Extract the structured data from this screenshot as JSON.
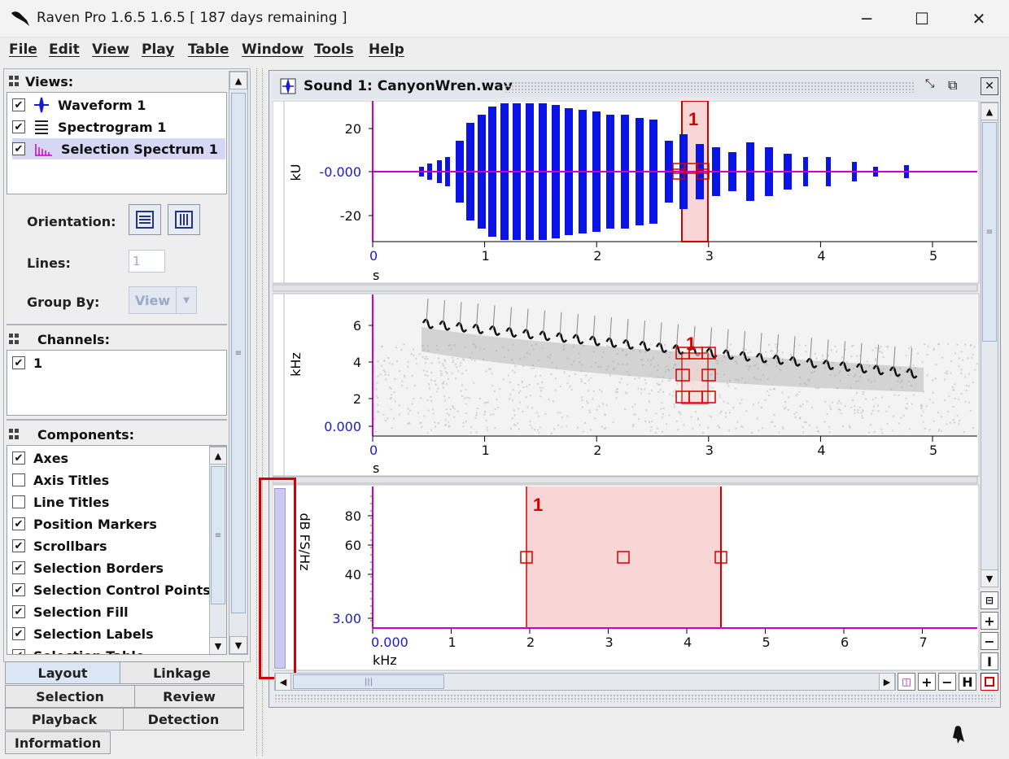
{
  "window": {
    "title": "Raven Pro 1.6.5 1.6.5  [ 187 days remaining ]",
    "min": "─",
    "max": "☐",
    "close": "✕"
  },
  "menu": [
    "File",
    "Edit",
    "View",
    "Play",
    "Table",
    "Window",
    "Tools",
    "Help"
  ],
  "left": {
    "views_title": "Views:",
    "views": [
      {
        "label": "Waveform 1",
        "checked": true
      },
      {
        "label": "Spectrogram 1",
        "checked": true
      },
      {
        "label": "Selection Spectrum 1",
        "checked": true
      }
    ],
    "orientation_label": "Orientation:",
    "lines_label": "Lines:",
    "lines_value": "1",
    "groupby_label": "Group By:",
    "groupby_value": "View",
    "channels_title": "Channels:",
    "channels": [
      {
        "label": "1",
        "checked": true
      }
    ],
    "components_title": "Components:",
    "components": [
      {
        "label": "Axes",
        "checked": true
      },
      {
        "label": "Axis Titles",
        "checked": false
      },
      {
        "label": "Line Titles",
        "checked": false
      },
      {
        "label": "Position Markers",
        "checked": true
      },
      {
        "label": "Scrollbars",
        "checked": true
      },
      {
        "label": "Selection Borders",
        "checked": true
      },
      {
        "label": "Selection Control Points",
        "checked": true
      },
      {
        "label": "Selection Fill",
        "checked": true
      },
      {
        "label": "Selection Labels",
        "checked": true
      },
      {
        "label": "Selection Table",
        "checked": true
      }
    ],
    "tabs": [
      "Layout",
      "Linkage",
      "Selection",
      "Review",
      "Playback",
      "Detection",
      "Information"
    ],
    "active_tab": "Layout"
  },
  "sound": {
    "title": "Sound 1: CanyonWren.wav",
    "waveform": {
      "ylabel": "kU",
      "yticks": [
        "20",
        "-0.000",
        "-20"
      ],
      "xticks": [
        "0",
        "1",
        "2",
        "3",
        "4",
        "5"
      ],
      "xunit": "s",
      "selection_label": "1"
    },
    "spectrogram": {
      "ylabel": "kHz",
      "yticks": [
        "6",
        "4",
        "2",
        "0.000"
      ],
      "xticks": [
        "0",
        "1",
        "2",
        "3",
        "4",
        "5"
      ],
      "xunit": "s",
      "selection_label": "1"
    },
    "spectrum": {
      "ylabel": "dB FS/Hz",
      "yticks": [
        "80",
        "60",
        "40",
        "3.00"
      ],
      "xticks": [
        "0.000",
        "1",
        "2",
        "3",
        "4",
        "5",
        "6",
        "7"
      ],
      "xunit": "kHz",
      "selection_label": "1"
    }
  },
  "colors": {
    "waveform": "#0a14e6",
    "axis": "#cc00cc",
    "selection": "#d40000",
    "selection_fill": "#f9d6d6",
    "tick_blue": "#1a1ad0"
  }
}
